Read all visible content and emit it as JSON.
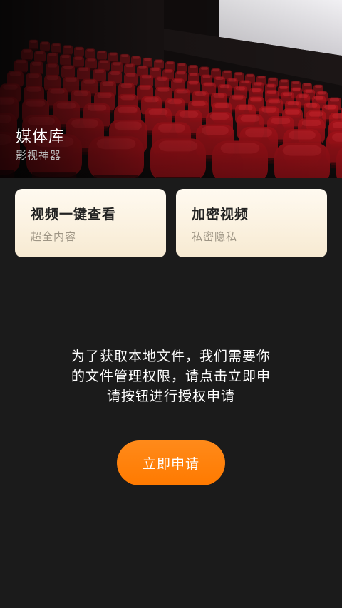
{
  "header": {
    "title": "媒体库",
    "subtitle": "影视神器"
  },
  "cards": [
    {
      "title": "视频一键查看",
      "subtitle": "超全内容"
    },
    {
      "title": "加密视频",
      "subtitle": "私密隐私"
    }
  ],
  "permission": {
    "message": "为了获取本地文件，我们需要你的文件管理权限，请点击立即申请按钮进行授权申请",
    "button_label": "立即申请"
  },
  "colors": {
    "accent": "#ff7d00",
    "background": "#1b1b1b",
    "card": "#fbf1e0",
    "seat": "#b3141c"
  }
}
